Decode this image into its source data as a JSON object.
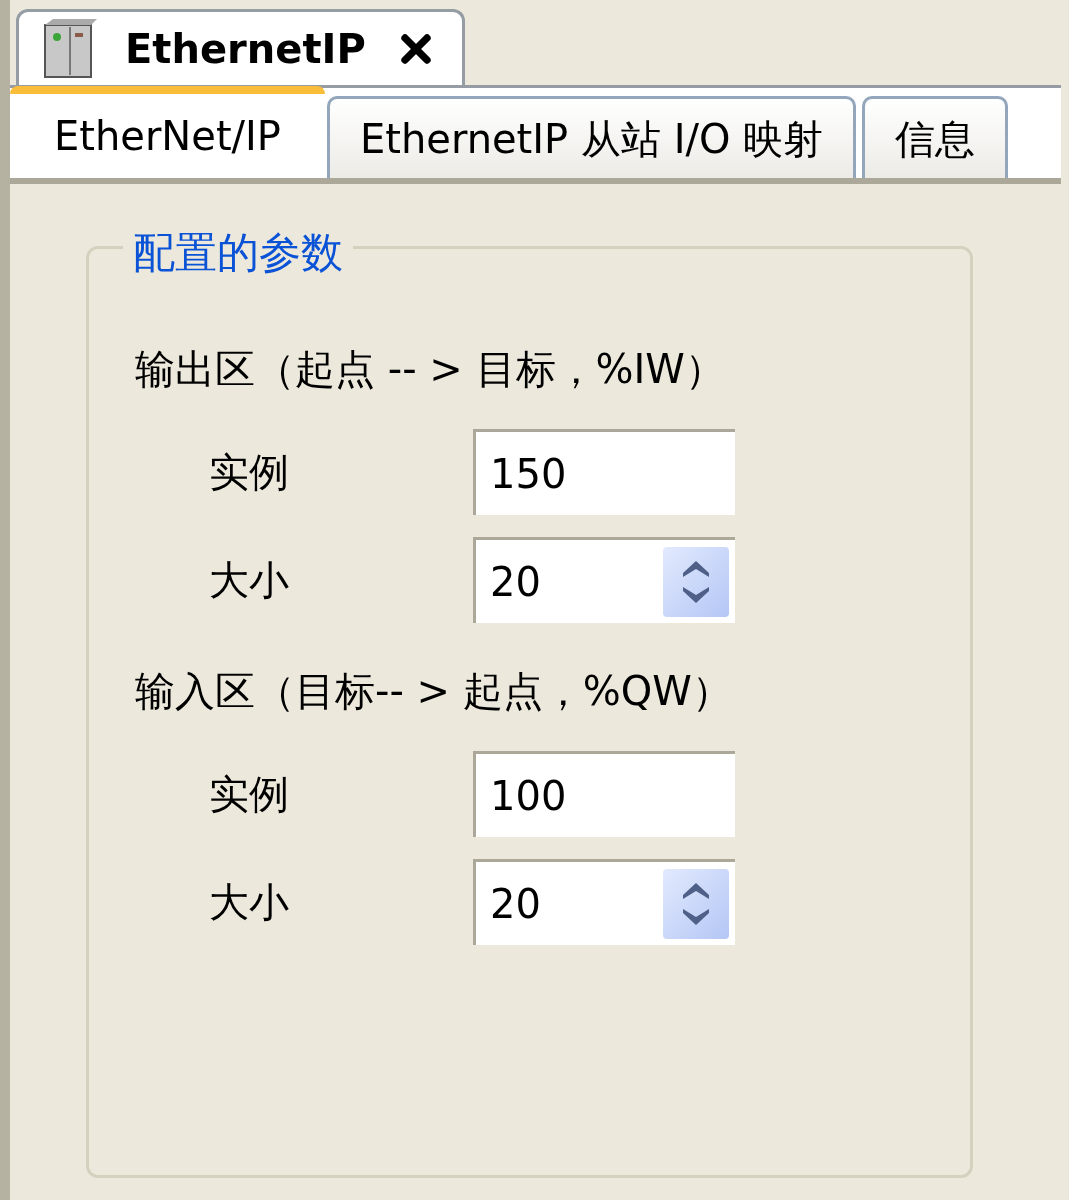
{
  "document_tab": {
    "title": "EthernetIP"
  },
  "tabs": [
    {
      "label": "EtherNet/IP",
      "selected": true
    },
    {
      "label": "EthernetIP 从站 I/O 映射",
      "selected": false
    },
    {
      "label": "信息",
      "selected": false
    }
  ],
  "group": {
    "legend": "配置的参数",
    "sections": [
      {
        "heading": "输出区（起点 -- > 目标，%IW）",
        "fields": [
          {
            "label": "实例",
            "value": "150",
            "kind": "text"
          },
          {
            "label": "大小",
            "value": "20",
            "kind": "spinner"
          }
        ]
      },
      {
        "heading": "输入区（目标-- > 起点，%QW）",
        "fields": [
          {
            "label": "实例",
            "value": "100",
            "kind": "text"
          },
          {
            "label": "大小",
            "value": "20",
            "kind": "spinner"
          }
        ]
      }
    ]
  }
}
